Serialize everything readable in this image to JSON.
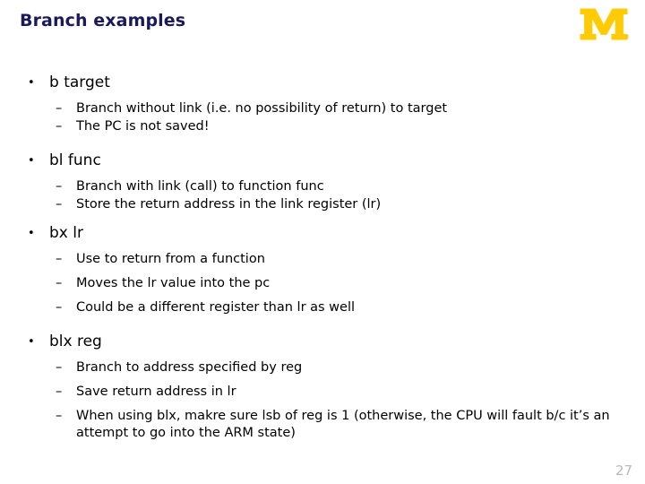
{
  "slide": {
    "title": "Branch examples",
    "page_number": "27",
    "title_color": "#19195c",
    "logo": {
      "name": "university-of-michigan-block-m",
      "color": "#ffcb05",
      "trademark": "®"
    },
    "bullet_glyph": "•",
    "dash_glyph": "–",
    "sections": [
      {
        "heading": "b target",
        "spacing": "tight",
        "points": [
          "Branch without link (i.e. no possibility of return) to target",
          "The PC is not saved!"
        ]
      },
      {
        "heading": "bl func",
        "spacing": "tight",
        "points": [
          "Branch with link (call) to function func",
          "Store the return address in the link register (lr)"
        ]
      },
      {
        "heading": "bx lr",
        "spacing": "loose",
        "points": [
          "Use to return from a function",
          "Moves the lr value into the pc",
          "Could be a different register than lr as well"
        ]
      },
      {
        "heading": "blx reg",
        "spacing": "loose",
        "points": [
          "Branch to address specified by reg",
          "Save return address in lr",
          "When using blx, makre sure lsb of reg is 1 (otherwise, the CPU will fault b/c it’s an attempt to go into the ARM state)"
        ]
      }
    ]
  }
}
